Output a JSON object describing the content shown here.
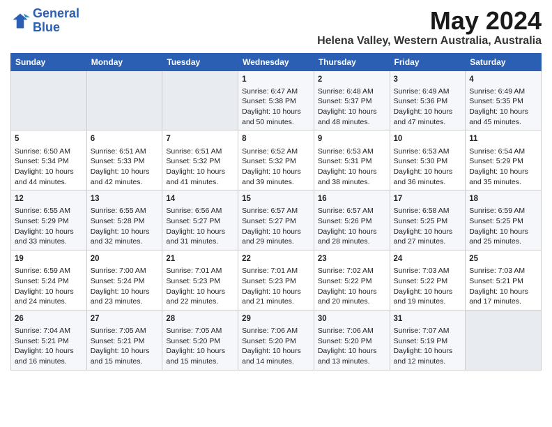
{
  "logo": {
    "line1": "General",
    "line2": "Blue"
  },
  "title": "May 2024",
  "location": "Helena Valley, Western Australia, Australia",
  "days_of_week": [
    "Sunday",
    "Monday",
    "Tuesday",
    "Wednesday",
    "Thursday",
    "Friday",
    "Saturday"
  ],
  "weeks": [
    [
      {
        "day": "",
        "empty": true
      },
      {
        "day": "",
        "empty": true
      },
      {
        "day": "",
        "empty": true
      },
      {
        "day": "1",
        "sunrise": "Sunrise: 6:47 AM",
        "sunset": "Sunset: 5:38 PM",
        "daylight": "Daylight: 10 hours and 50 minutes."
      },
      {
        "day": "2",
        "sunrise": "Sunrise: 6:48 AM",
        "sunset": "Sunset: 5:37 PM",
        "daylight": "Daylight: 10 hours and 48 minutes."
      },
      {
        "day": "3",
        "sunrise": "Sunrise: 6:49 AM",
        "sunset": "Sunset: 5:36 PM",
        "daylight": "Daylight: 10 hours and 47 minutes."
      },
      {
        "day": "4",
        "sunrise": "Sunrise: 6:49 AM",
        "sunset": "Sunset: 5:35 PM",
        "daylight": "Daylight: 10 hours and 45 minutes."
      }
    ],
    [
      {
        "day": "5",
        "sunrise": "Sunrise: 6:50 AM",
        "sunset": "Sunset: 5:34 PM",
        "daylight": "Daylight: 10 hours and 44 minutes."
      },
      {
        "day": "6",
        "sunrise": "Sunrise: 6:51 AM",
        "sunset": "Sunset: 5:33 PM",
        "daylight": "Daylight: 10 hours and 42 minutes."
      },
      {
        "day": "7",
        "sunrise": "Sunrise: 6:51 AM",
        "sunset": "Sunset: 5:32 PM",
        "daylight": "Daylight: 10 hours and 41 minutes."
      },
      {
        "day": "8",
        "sunrise": "Sunrise: 6:52 AM",
        "sunset": "Sunset: 5:32 PM",
        "daylight": "Daylight: 10 hours and 39 minutes."
      },
      {
        "day": "9",
        "sunrise": "Sunrise: 6:53 AM",
        "sunset": "Sunset: 5:31 PM",
        "daylight": "Daylight: 10 hours and 38 minutes."
      },
      {
        "day": "10",
        "sunrise": "Sunrise: 6:53 AM",
        "sunset": "Sunset: 5:30 PM",
        "daylight": "Daylight: 10 hours and 36 minutes."
      },
      {
        "day": "11",
        "sunrise": "Sunrise: 6:54 AM",
        "sunset": "Sunset: 5:29 PM",
        "daylight": "Daylight: 10 hours and 35 minutes."
      }
    ],
    [
      {
        "day": "12",
        "sunrise": "Sunrise: 6:55 AM",
        "sunset": "Sunset: 5:29 PM",
        "daylight": "Daylight: 10 hours and 33 minutes."
      },
      {
        "day": "13",
        "sunrise": "Sunrise: 6:55 AM",
        "sunset": "Sunset: 5:28 PM",
        "daylight": "Daylight: 10 hours and 32 minutes."
      },
      {
        "day": "14",
        "sunrise": "Sunrise: 6:56 AM",
        "sunset": "Sunset: 5:27 PM",
        "daylight": "Daylight: 10 hours and 31 minutes."
      },
      {
        "day": "15",
        "sunrise": "Sunrise: 6:57 AM",
        "sunset": "Sunset: 5:27 PM",
        "daylight": "Daylight: 10 hours and 29 minutes."
      },
      {
        "day": "16",
        "sunrise": "Sunrise: 6:57 AM",
        "sunset": "Sunset: 5:26 PM",
        "daylight": "Daylight: 10 hours and 28 minutes."
      },
      {
        "day": "17",
        "sunrise": "Sunrise: 6:58 AM",
        "sunset": "Sunset: 5:25 PM",
        "daylight": "Daylight: 10 hours and 27 minutes."
      },
      {
        "day": "18",
        "sunrise": "Sunrise: 6:59 AM",
        "sunset": "Sunset: 5:25 PM",
        "daylight": "Daylight: 10 hours and 25 minutes."
      }
    ],
    [
      {
        "day": "19",
        "sunrise": "Sunrise: 6:59 AM",
        "sunset": "Sunset: 5:24 PM",
        "daylight": "Daylight: 10 hours and 24 minutes."
      },
      {
        "day": "20",
        "sunrise": "Sunrise: 7:00 AM",
        "sunset": "Sunset: 5:24 PM",
        "daylight": "Daylight: 10 hours and 23 minutes."
      },
      {
        "day": "21",
        "sunrise": "Sunrise: 7:01 AM",
        "sunset": "Sunset: 5:23 PM",
        "daylight": "Daylight: 10 hours and 22 minutes."
      },
      {
        "day": "22",
        "sunrise": "Sunrise: 7:01 AM",
        "sunset": "Sunset: 5:23 PM",
        "daylight": "Daylight: 10 hours and 21 minutes."
      },
      {
        "day": "23",
        "sunrise": "Sunrise: 7:02 AM",
        "sunset": "Sunset: 5:22 PM",
        "daylight": "Daylight: 10 hours and 20 minutes."
      },
      {
        "day": "24",
        "sunrise": "Sunrise: 7:03 AM",
        "sunset": "Sunset: 5:22 PM",
        "daylight": "Daylight: 10 hours and 19 minutes."
      },
      {
        "day": "25",
        "sunrise": "Sunrise: 7:03 AM",
        "sunset": "Sunset: 5:21 PM",
        "daylight": "Daylight: 10 hours and 17 minutes."
      }
    ],
    [
      {
        "day": "26",
        "sunrise": "Sunrise: 7:04 AM",
        "sunset": "Sunset: 5:21 PM",
        "daylight": "Daylight: 10 hours and 16 minutes."
      },
      {
        "day": "27",
        "sunrise": "Sunrise: 7:05 AM",
        "sunset": "Sunset: 5:21 PM",
        "daylight": "Daylight: 10 hours and 15 minutes."
      },
      {
        "day": "28",
        "sunrise": "Sunrise: 7:05 AM",
        "sunset": "Sunset: 5:20 PM",
        "daylight": "Daylight: 10 hours and 15 minutes."
      },
      {
        "day": "29",
        "sunrise": "Sunrise: 7:06 AM",
        "sunset": "Sunset: 5:20 PM",
        "daylight": "Daylight: 10 hours and 14 minutes."
      },
      {
        "day": "30",
        "sunrise": "Sunrise: 7:06 AM",
        "sunset": "Sunset: 5:20 PM",
        "daylight": "Daylight: 10 hours and 13 minutes."
      },
      {
        "day": "31",
        "sunrise": "Sunrise: 7:07 AM",
        "sunset": "Sunset: 5:19 PM",
        "daylight": "Daylight: 10 hours and 12 minutes."
      },
      {
        "day": "",
        "empty": true
      }
    ]
  ]
}
